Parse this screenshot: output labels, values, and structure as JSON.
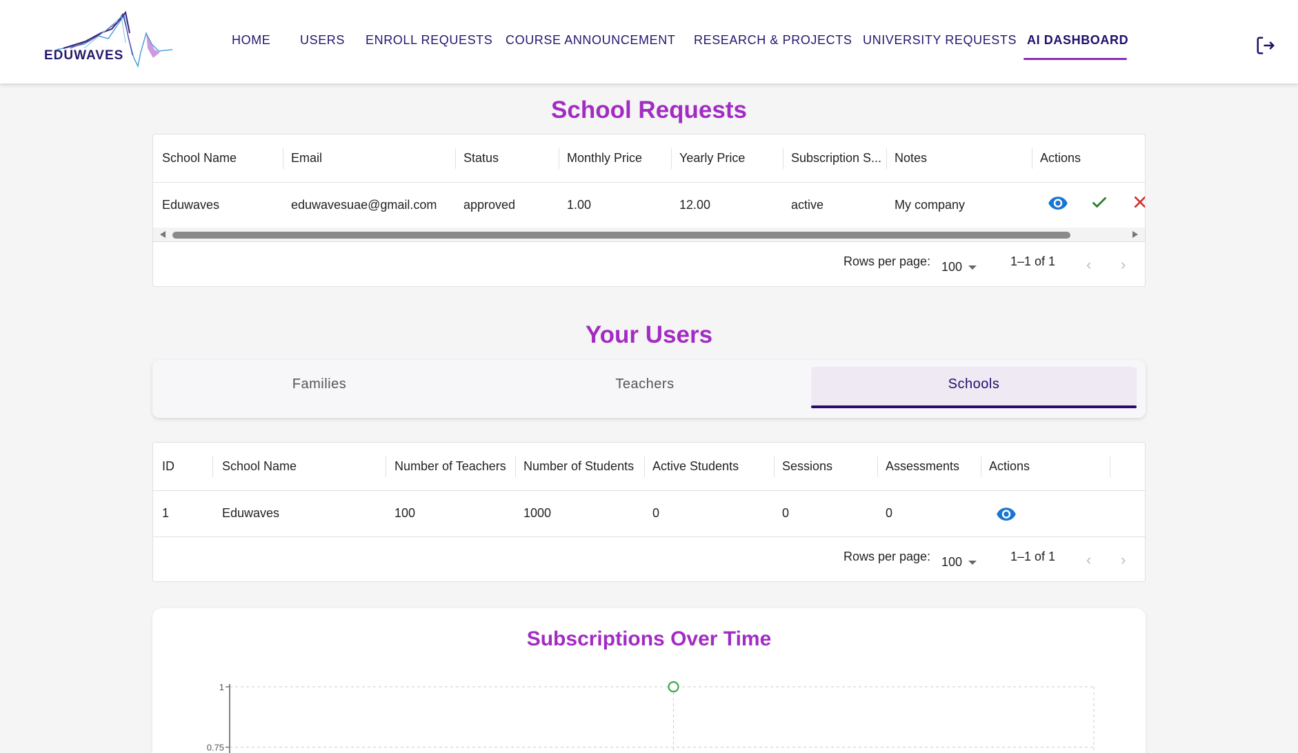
{
  "header": {
    "logo_text": "EDUWAVES",
    "nav": [
      "HOME",
      "USERS",
      "ENROLL REQUESTS",
      "COURSE ANNOUNCEMENT",
      "RESEARCH & PROJECTS",
      "UNIVERSITY REQUESTS",
      "AI DASHBOARD"
    ],
    "active_nav": "AI DASHBOARD"
  },
  "school_requests": {
    "title": "School Requests",
    "columns": [
      "School Name",
      "Email",
      "Status",
      "Monthly Price",
      "Yearly Price",
      "Subscription S...",
      "Notes",
      "Actions"
    ],
    "rows": [
      {
        "school_name": "Eduwaves",
        "email": "eduwavesuae@gmail.com",
        "status": "approved",
        "monthly_price": "1.00",
        "yearly_price": "12.00",
        "subscription_status": "active",
        "notes": "My company"
      }
    ],
    "rows_per_page_label": "Rows per page:",
    "rows_per_page": "100",
    "range": "1–1 of 1"
  },
  "your_users": {
    "title": "Your Users",
    "tabs": [
      "Families",
      "Teachers",
      "Schools"
    ],
    "active_tab": "Schools",
    "columns": [
      "ID",
      "School Name",
      "Number of Teachers",
      "Number of Students",
      "Active Students",
      "Sessions",
      "Assessments",
      "Actions"
    ],
    "rows": [
      {
        "id": "1",
        "school_name": "Eduwaves",
        "teachers": "100",
        "students": "1000",
        "active_students": "0",
        "sessions": "0",
        "assessments": "0"
      }
    ],
    "rows_per_page_label": "Rows per page:",
    "rows_per_page": "100",
    "range": "1–1 of 1"
  },
  "chart_data": {
    "type": "line",
    "title": "Subscriptions Over Time",
    "xlabel": "",
    "ylabel": "",
    "y_ticks": [
      "1",
      "0.75"
    ],
    "series": [
      {
        "values": [
          1
        ]
      }
    ],
    "grid": true,
    "colors": {
      "point": "#3aa64a"
    }
  },
  "colors": {
    "accent": "#a22cc3",
    "nav": "#23166e",
    "view_icon": "#1976d2",
    "approve_icon": "#2e7d32",
    "reject_icon": "#d32f2f"
  },
  "icons": {
    "logout": "logout-icon",
    "view": "eye-icon",
    "approve": "check-icon",
    "reject": "close-icon"
  }
}
